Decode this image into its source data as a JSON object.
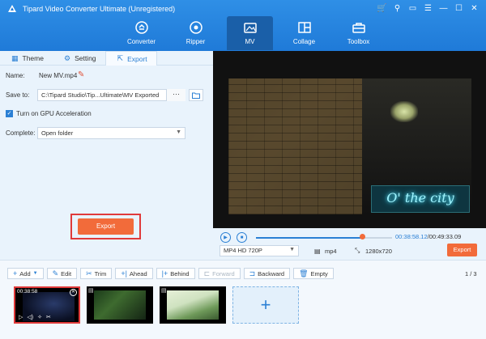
{
  "window": {
    "title": "Tipard Video Converter Ultimate (Unregistered)"
  },
  "nav": [
    {
      "label": "Converter",
      "icon": "converter-icon"
    },
    {
      "label": "Ripper",
      "icon": "ripper-icon"
    },
    {
      "label": "MV",
      "icon": "mv-icon",
      "active": true
    },
    {
      "label": "Collage",
      "icon": "collage-icon"
    },
    {
      "label": "Toolbox",
      "icon": "toolbox-icon"
    }
  ],
  "tabs": {
    "theme": "Theme",
    "setting": "Setting",
    "export": "Export"
  },
  "export_panel": {
    "name_label": "Name:",
    "name_value": "New MV.mp4",
    "save_label": "Save to:",
    "save_path": "C:\\Tipard Studio\\Tip...Ultimate\\MV Exported",
    "browse": "···",
    "gpu_label": "Turn on GPU Acceleration",
    "complete_label": "Complete:",
    "complete_value": "Open folder",
    "export_button": "Export"
  },
  "video": {
    "neon_text": "O' the city"
  },
  "playback": {
    "current_time": "00:38:58.12",
    "total_time": "/00:49:33.09",
    "progress": 0.78,
    "format": "MP4 HD 720P",
    "container": "mp4",
    "resolution": "1280x720",
    "export_button": "Export"
  },
  "toolbar": {
    "add": "Add",
    "edit": "Edit",
    "trim": "Trim",
    "ahead": "Ahead",
    "behind": "Behind",
    "forward": "Forward",
    "backward": "Backward",
    "empty": "Empty",
    "page": "1 / 3"
  },
  "clips": [
    {
      "time": "00:38:58"
    }
  ],
  "colors": {
    "accent": "#2a7fd4",
    "export": "#f26b3a",
    "header": "#1f7ad8"
  }
}
